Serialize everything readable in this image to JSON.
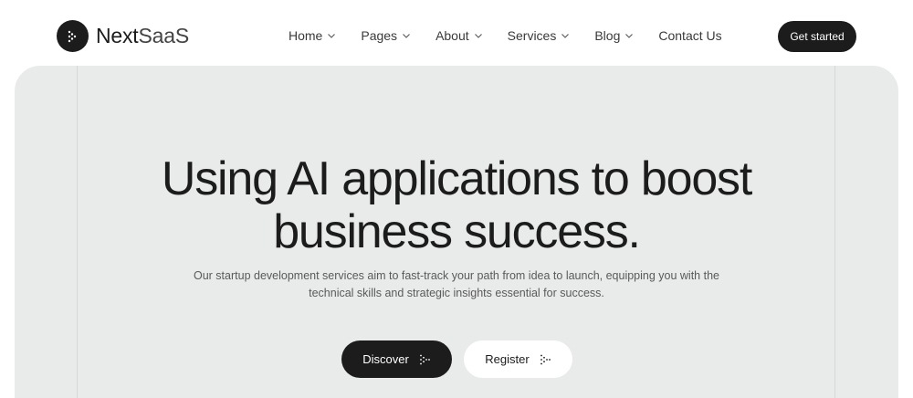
{
  "brand": {
    "name_part1": "Next",
    "name_part2": "SaaS",
    "logo_icon": "dotted-arrow-icon"
  },
  "nav": {
    "items": [
      {
        "label": "Home",
        "has_dropdown": true
      },
      {
        "label": "Pages",
        "has_dropdown": true
      },
      {
        "label": "About",
        "has_dropdown": true
      },
      {
        "label": "Services",
        "has_dropdown": true
      },
      {
        "label": "Blog",
        "has_dropdown": true
      },
      {
        "label": "Contact Us",
        "has_dropdown": false
      }
    ]
  },
  "header": {
    "cta_label": "Get started"
  },
  "hero": {
    "title_line1": "Using AI applications to boost",
    "title_line2": "business success.",
    "subtitle_line1": "Our startup development services aim to fast-track your path from idea to launch, equipping you with the",
    "subtitle_line2": "technical skills and strategic insights essential for success.",
    "primary_button": "Discover",
    "secondary_button": "Register",
    "button_icon": "dotted-arrow-icon"
  },
  "colors": {
    "dark": "#1c1c1c",
    "hero_background": "#e9eaea",
    "page_background": "#ffffff",
    "text_muted": "#5a5a5a"
  }
}
